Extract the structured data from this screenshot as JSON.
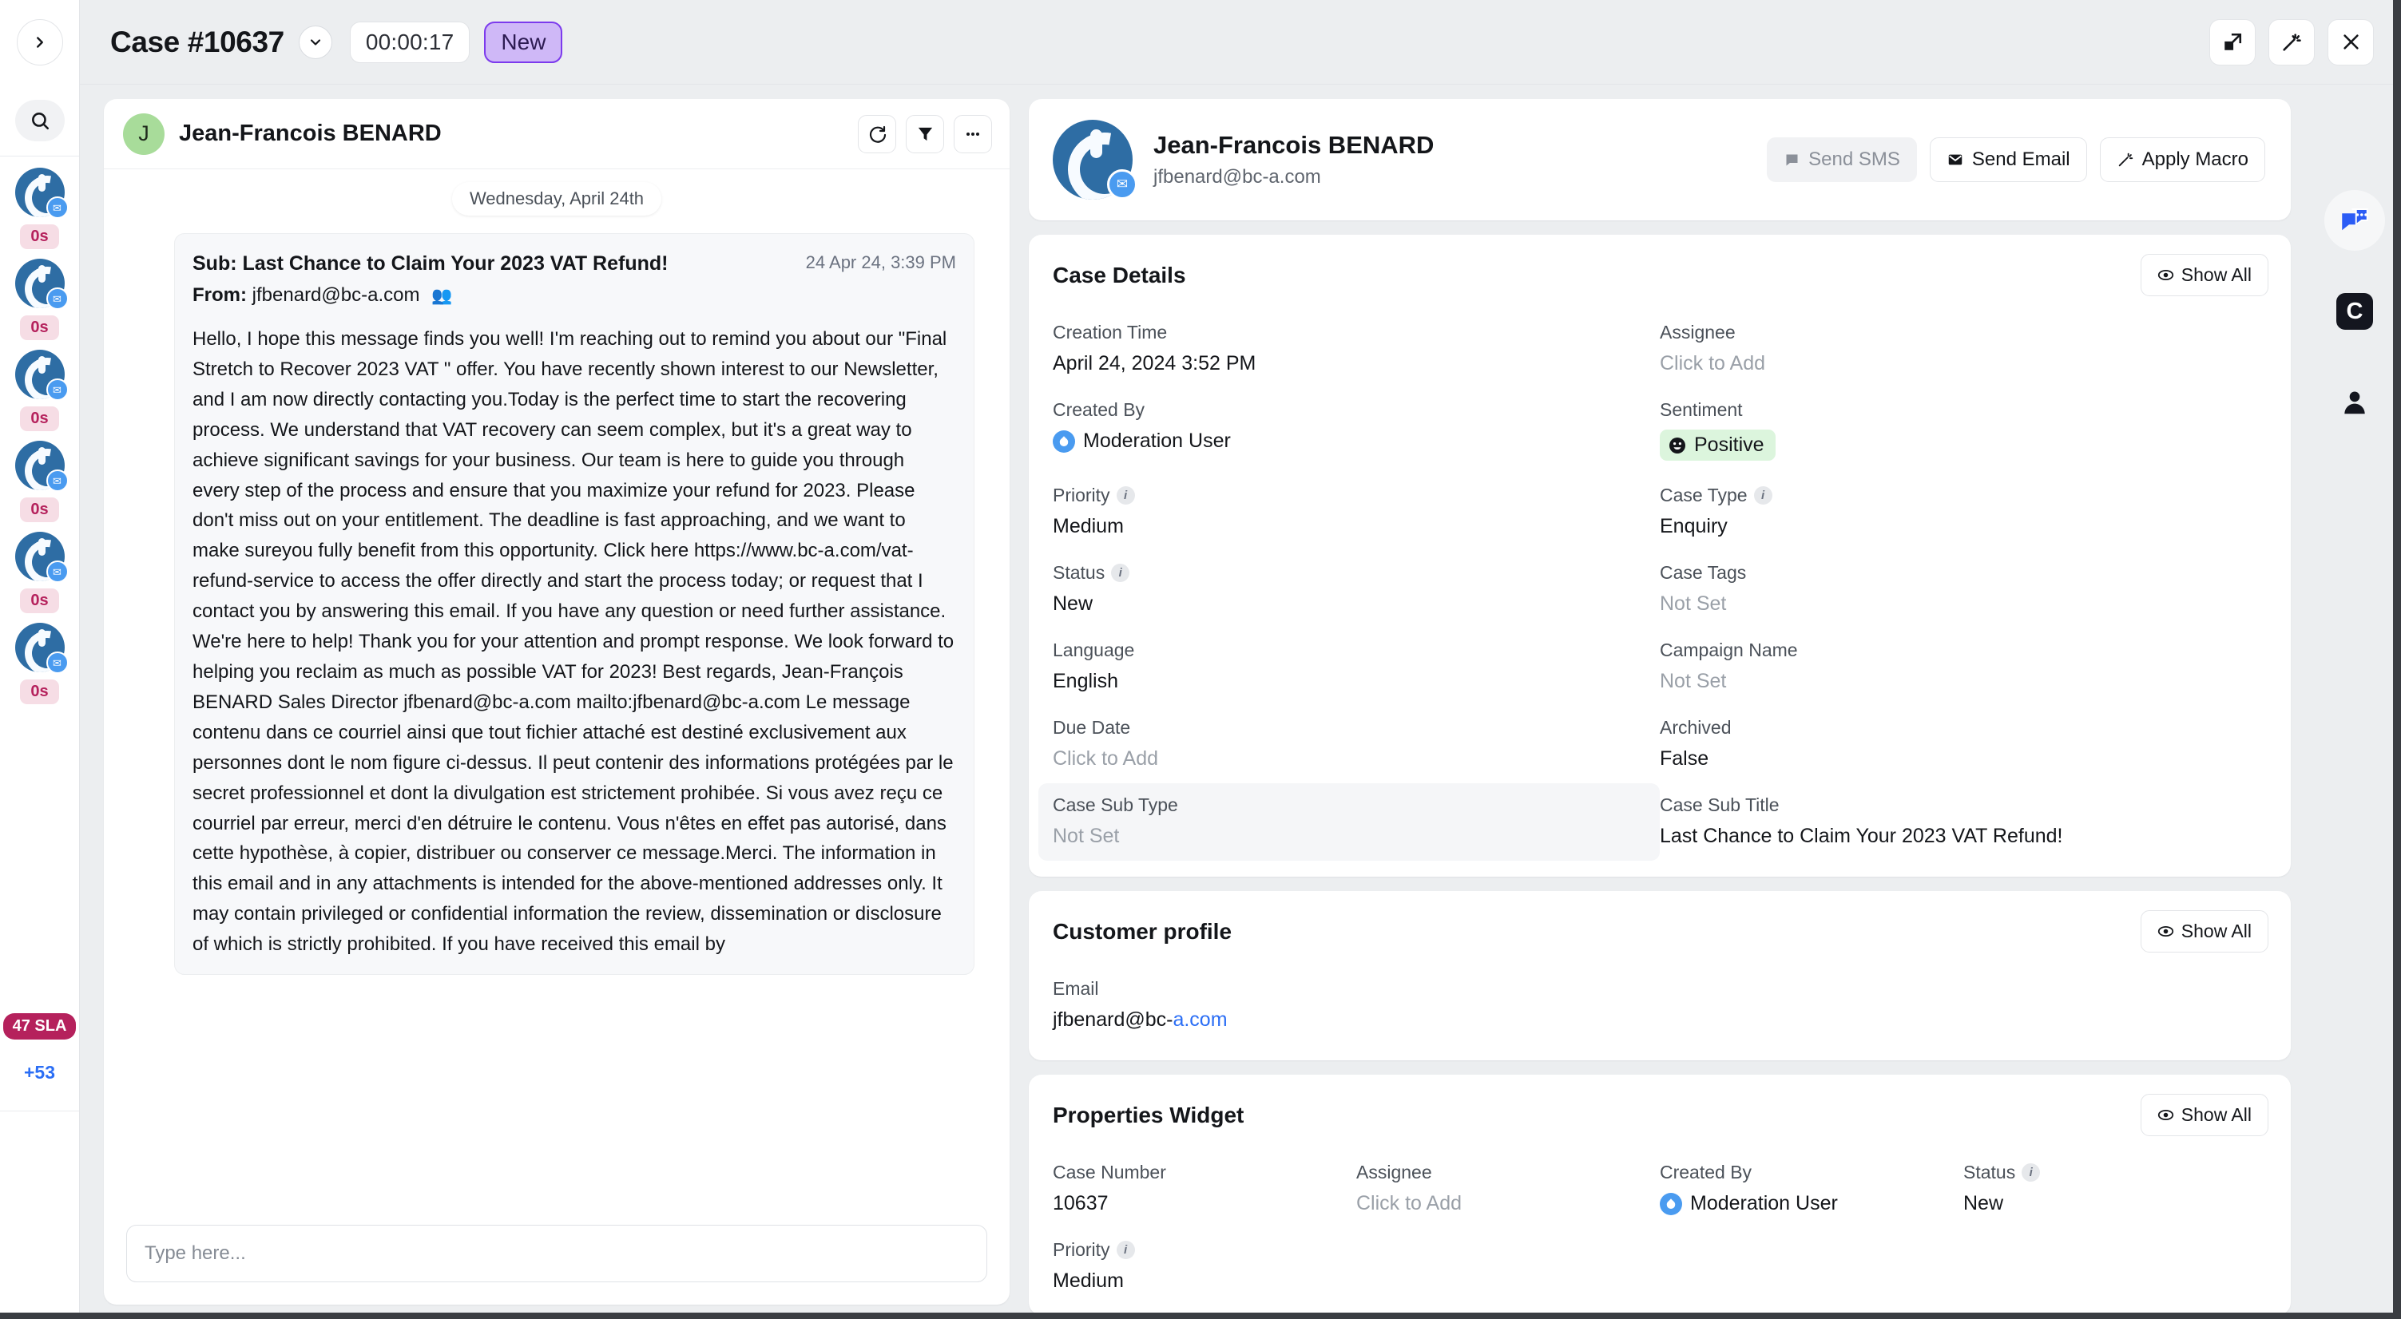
{
  "header": {
    "case_title": "Case #10637",
    "chevron_icon": "chevron-down-icon",
    "timer": "00:00:17",
    "status": "New",
    "status_color": "#cfb8f7",
    "buttons": [
      {
        "name": "popout-button",
        "icon": "popout-icon"
      },
      {
        "name": "magic-wand-button",
        "icon": "magic-wand-icon"
      },
      {
        "name": "close-button",
        "icon": "close-icon"
      }
    ]
  },
  "left_rail": {
    "expand_icon": "chevron-right-icon",
    "search_icon": "search-icon",
    "items": [
      {
        "badge": "0s",
        "channel_icon": "email-icon"
      },
      {
        "badge": "0s",
        "channel_icon": "email-icon"
      },
      {
        "badge": "0s",
        "channel_icon": "email-icon"
      },
      {
        "badge": "0s",
        "channel_icon": "email-icon"
      },
      {
        "badge": "0s",
        "channel_icon": "email-icon"
      },
      {
        "badge": "0s",
        "channel_icon": "email-icon"
      }
    ],
    "sla_badge": "47 SLA",
    "more_count": "+53"
  },
  "conversation": {
    "avatar_initial": "J",
    "contact_name": "Jean-Francois BENARD",
    "head_buttons": [
      {
        "name": "refresh-button",
        "icon": "refresh-icon"
      },
      {
        "name": "filter-button",
        "icon": "filter-icon"
      },
      {
        "name": "more-options-button",
        "icon": "ellipsis-icon"
      }
    ],
    "day_divider": "Wednesday, April 24th",
    "message": {
      "subject": "Sub: Last Chance to Claim Your 2023 VAT Refund!",
      "time": "24 Apr 24, 3:39 PM",
      "from_label": "From:",
      "from_value": "jfbenard@bc-a.com",
      "recipients_icon": "people-icon",
      "body": "Hello, I hope this message finds you well! I'm reaching out to remind you about our \"Final Stretch to Recover 2023 VAT \" offer. You have recently shown interest to our Newsletter, and I am now directly contacting you.Today is the perfect time to start the recovering process. We understand that VAT recovery can seem complex, but it's a great way to achieve significant savings for your business. Our team is here to guide you through every step of the process and ensure that you maximize your refund for 2023. Please don't miss out on your entitlement. The deadline is fast approaching, and we want to make sureyou fully benefit from this opportunity. Click here https://www.bc-a.com/vat-refund-service to access the offer directly and start the process today; or request that I contact you by answering this email. If you have any question or need further assistance. We're here to help! Thank you for your attention and prompt response. We look forward to helping you reclaim as much as possible VAT for 2023! Best regards, Jean-François BENARD Sales Director jfbenard@bc-a.com mailto:jfbenard@bc-a.com Le message contenu dans ce courriel ainsi que tout fichier attaché est destiné exclusivement aux personnes dont le nom figure ci-dessus. Il peut contenir des informations protégées par le secret professionnel et dont la divulgation est strictement prohibée. Si vous avez reçu ce courriel par erreur, merci d'en détruire le contenu. Vous n'êtes en effet pas autorisé, dans cette hypothèse, à copier, distribuer ou conserver ce message.Merci. The information in this email and in any attachments is intended for the above-mentioned addresses only. It may contain privileged or confidential information the review, dissemination or disclosure of which is strictly prohibited. If you have received this email by"
    },
    "composer_placeholder": "Type here..."
  },
  "contact_card": {
    "name": "Jean-Francois BENARD",
    "email": "jfbenard@bc-a.com",
    "channel_icon": "email-icon",
    "actions": [
      {
        "name": "send-sms-button",
        "label": "Send SMS",
        "icon": "sms-icon",
        "disabled": true
      },
      {
        "name": "send-email-button",
        "label": "Send Email",
        "icon": "email-icon",
        "disabled": false
      },
      {
        "name": "apply-macro-button",
        "label": "Apply Macro",
        "icon": "magic-wand-icon",
        "disabled": false
      }
    ]
  },
  "case_details": {
    "title": "Case Details",
    "show_all": "Show All",
    "show_all_icon": "eye-icon",
    "fields": [
      {
        "label": "Creation Time",
        "value": "April 24, 2024 3:52 PM",
        "muted": false,
        "info": false
      },
      {
        "label": "Assignee",
        "value": "Click to Add",
        "muted": true,
        "info": false
      },
      {
        "label": "Created By",
        "value": "Moderation User",
        "muted": false,
        "info": false,
        "avatar": "moderation-user-icon"
      },
      {
        "label": "Sentiment",
        "value": "Positive",
        "muted": false,
        "info": false,
        "chip": "positive",
        "chip_icon": "smiley-icon",
        "chip_color": "#dcf5dd"
      },
      {
        "label": "Priority",
        "value": "Medium",
        "muted": false,
        "info": true
      },
      {
        "label": "Case Type",
        "value": "Enquiry",
        "muted": false,
        "info": true
      },
      {
        "label": "Status",
        "value": "New",
        "muted": false,
        "info": true
      },
      {
        "label": "Case Tags",
        "value": "Not Set",
        "muted": true,
        "info": false
      },
      {
        "label": "Language",
        "value": "English",
        "muted": false,
        "info": false
      },
      {
        "label": "Campaign Name",
        "value": "Not Set",
        "muted": true,
        "info": false
      },
      {
        "label": "Due Date",
        "value": "Click to Add",
        "muted": true,
        "info": false
      },
      {
        "label": "Archived",
        "value": "False",
        "muted": false,
        "info": false
      },
      {
        "label": "Case Sub Type",
        "value": "Not Set",
        "muted": true,
        "info": false,
        "highlight": true
      },
      {
        "label": "Case Sub Title",
        "value": "Last Chance to Claim Your 2023 VAT Refund!",
        "muted": false,
        "info": false
      }
    ]
  },
  "customer_profile": {
    "title": "Customer profile",
    "show_all": "Show All",
    "fields": [
      {
        "label": "Email",
        "value": "jfbenard@bc-",
        "link": "a.com"
      }
    ]
  },
  "properties_widget": {
    "title": "Properties Widget",
    "show_all": "Show All",
    "fields": [
      {
        "label": "Case Number",
        "value": "10637",
        "muted": false,
        "info": false
      },
      {
        "label": "Assignee",
        "value": "Click to Add",
        "muted": true,
        "info": false
      },
      {
        "label": "Created By",
        "value": "Moderation User",
        "muted": false,
        "info": false,
        "avatar": "moderation-user-icon"
      },
      {
        "label": "Status",
        "value": "New",
        "muted": false,
        "info": true
      },
      {
        "label": "Priority",
        "value": "Medium",
        "muted": false,
        "info": true
      }
    ]
  },
  "right_rail": {
    "buttons": [
      {
        "name": "chat-panel-button",
        "icon": "chat-bubbles-icon",
        "active": true
      },
      {
        "name": "copilot-button",
        "icon": "c-square-icon",
        "active": false
      },
      {
        "name": "contact-panel-button",
        "icon": "person-icon",
        "active": false
      }
    ]
  }
}
